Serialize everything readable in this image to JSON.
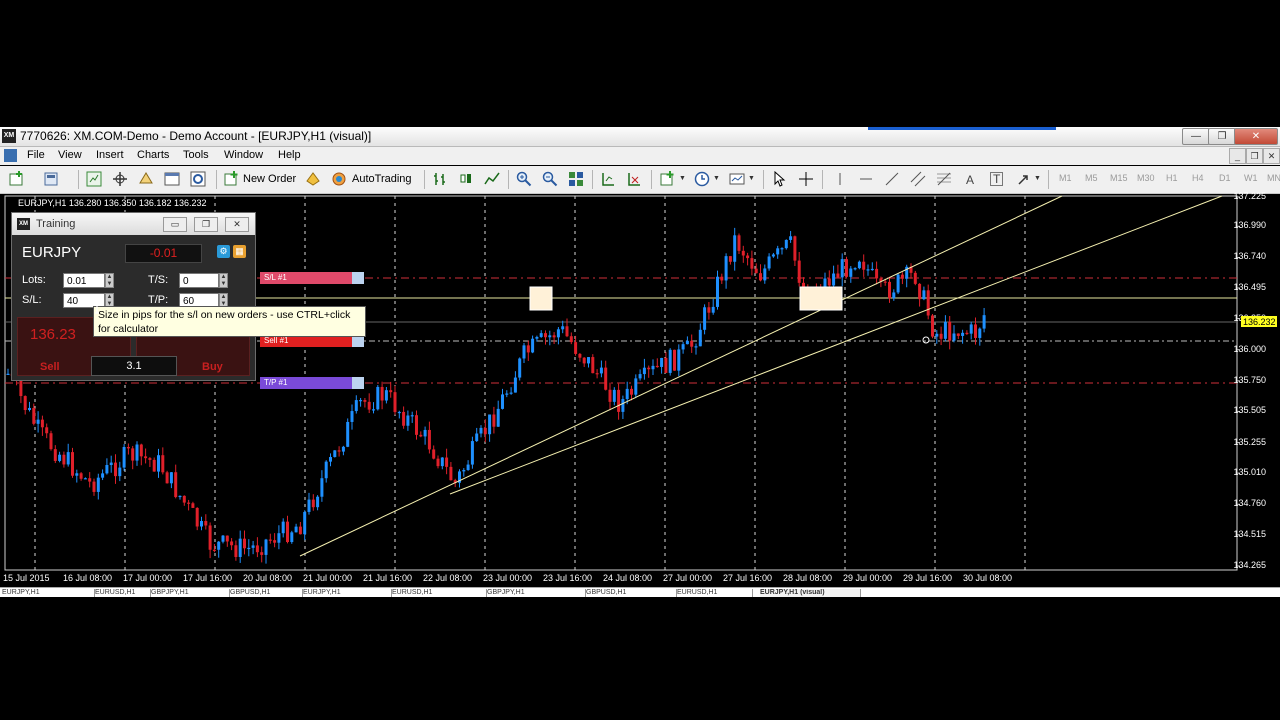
{
  "window": {
    "title": "7770626: XM.COM-Demo - Demo Account - [EURJPY,H1 (visual)]",
    "logo": "XM",
    "minimize_glyph": "—",
    "restore_glyph": "❐",
    "close_glyph": "✕"
  },
  "menu": {
    "items": [
      "File",
      "View",
      "Insert",
      "Charts",
      "Tools",
      "Window",
      "Help"
    ]
  },
  "toolbar": {
    "new_order_label": "New Order",
    "autotrading_label": "AutoTrading",
    "timeframes": [
      "M1",
      "M5",
      "M15",
      "M30",
      "H1",
      "H4",
      "D1",
      "W1",
      "MN"
    ]
  },
  "chart": {
    "header": "EURJPY,H1  136.280 136.350 136.182 136.232",
    "current_price": "136.232",
    "price_axis": [
      "137.225",
      "136.990",
      "136.740",
      "136.495",
      "136.250",
      "136.000",
      "135.750",
      "135.505",
      "135.255",
      "135.010",
      "134.760",
      "134.515",
      "134.265"
    ],
    "time_axis": [
      "15 Jul 2015",
      "16 Jul 08:00",
      "17 Jul 00:00",
      "17 Jul 16:00",
      "20 Jul 08:00",
      "21 Jul 00:00",
      "21 Jul 16:00",
      "22 Jul 08:00",
      "23 Jul 00:00",
      "23 Jul 16:00",
      "24 Jul 08:00",
      "27 Jul 00:00",
      "27 Jul 16:00",
      "28 Jul 08:00",
      "29 Jul 00:00",
      "29 Jul 16:00",
      "30 Jul 08:00"
    ],
    "lines": {
      "sl_label": "S/L #1",
      "sell_label": "Sell #1",
      "tp_label": "T/P #1"
    },
    "colors": {
      "bull": "#1e90ff",
      "bear": "#e0202a",
      "trend": "#f5f0b0",
      "grid": "#d8d8d8",
      "sl": "#e04a6a",
      "sell": "#e02020",
      "tp": "#7a4ad8"
    }
  },
  "tabs": [
    "EURJPY,H1",
    "EURUSD,H1",
    "GBPJPY,H1",
    "GBPUSD,H1",
    "EURJPY,H1",
    "EURUSD,H1",
    "GBPJPY,H1",
    "GBPUSD,H1",
    "EURUSD,H1",
    "EURJPY,H1 (visual)"
  ],
  "training": {
    "title": "Training",
    "symbol": "EURJPY",
    "pl": "-0.01",
    "lots_label": "Lots:",
    "lots_value": "0.01",
    "ts_label": "T/S:",
    "ts_value": "0",
    "sl_label": "S/L:",
    "sl_value": "40",
    "tp_label": "T/P:",
    "tp_value": "60",
    "sell_price": "136.23",
    "sell_label": "Sell",
    "buy_label": "Buy",
    "spread": "3.1",
    "tooltip": "Size in pips for the s/l on new orders - use CTRL+click for calculator"
  }
}
